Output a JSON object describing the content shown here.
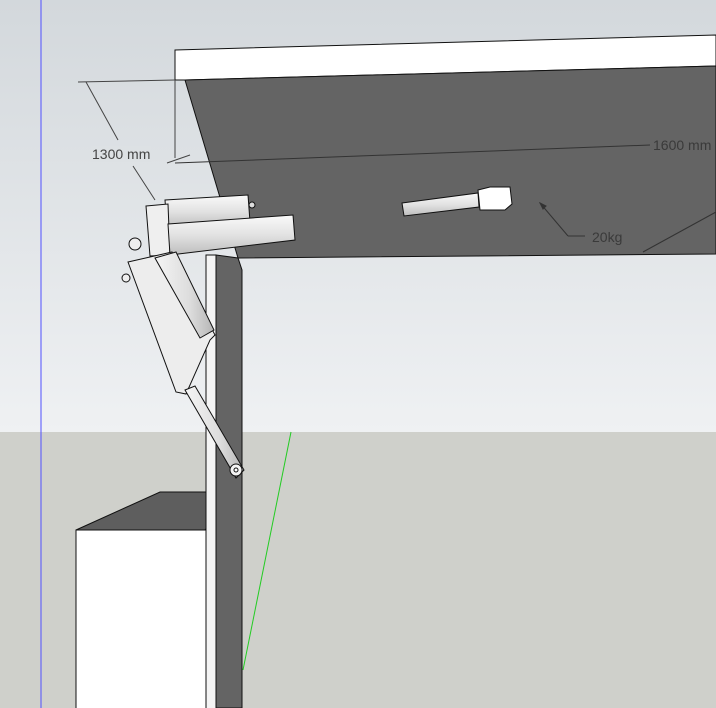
{
  "scene": {
    "dimensions": {
      "height_label": "1300 mm",
      "length_label": "1600 mm"
    },
    "load_label": "20kg",
    "colors": {
      "sky_top": "#d3d8dc",
      "sky_bottom": "#eff1f3",
      "ground": "#cfd0cb",
      "panel_dark": "#646464",
      "white_face": "#ffffff",
      "blue_axis": "#4040ff",
      "green_axis": "#22cc22"
    }
  }
}
